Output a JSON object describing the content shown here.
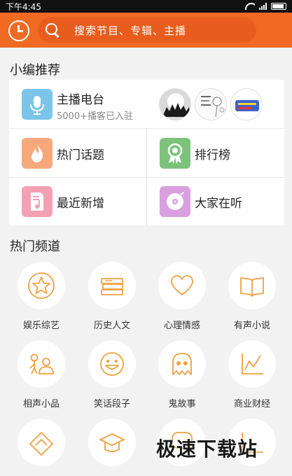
{
  "status_bar": {
    "time": "下午4:45"
  },
  "search": {
    "placeholder": "搜索节目、专辑、主播"
  },
  "editor_picks": {
    "title": "小编推荐",
    "host_radio": {
      "title": "主播电台",
      "subtitle": "5000+播客已入驻"
    },
    "items": [
      {
        "label": "热门话题",
        "icon": "flame-icon",
        "color": "#f7a87a"
      },
      {
        "label": "排行榜",
        "icon": "medal-icon",
        "color": "#7cc27a"
      },
      {
        "label": "最近新增",
        "icon": "music-doc-icon",
        "color": "#f4a0b4"
      },
      {
        "label": "大家在听",
        "icon": "disc-icon",
        "color": "#d9a0e0"
      }
    ],
    "host_icon_color": "#7cc4ea"
  },
  "channels": {
    "title": "热门频道",
    "items": [
      {
        "label": "娱乐综艺",
        "icon": "star-icon"
      },
      {
        "label": "历史人文",
        "icon": "books-icon"
      },
      {
        "label": "心理情感",
        "icon": "heart-icon"
      },
      {
        "label": "有声小说",
        "icon": "open-book-icon"
      },
      {
        "label": "相声小品",
        "icon": "comedy-icon"
      },
      {
        "label": "笑话段子",
        "icon": "smiley-icon"
      },
      {
        "label": "鬼故事",
        "icon": "ghost-icon"
      },
      {
        "label": "商业财经",
        "icon": "chart-icon"
      }
    ],
    "accent": "#f0a040"
  },
  "watermark": "极速下载站"
}
